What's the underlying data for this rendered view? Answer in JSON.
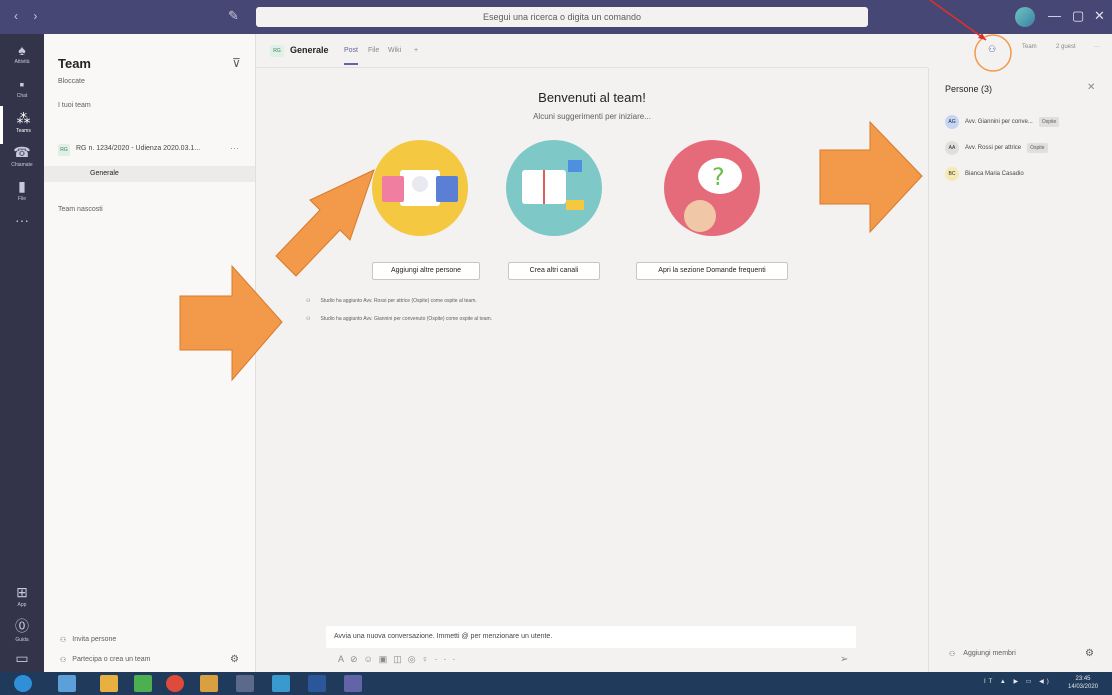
{
  "titlebar": {
    "search_placeholder": "Esegui una ricerca o digita un comando"
  },
  "rail": [
    {
      "label": "Attività",
      "icon": "bell-icon"
    },
    {
      "label": "Chat",
      "icon": "chat-icon"
    },
    {
      "label": "Teams",
      "icon": "teams-icon"
    },
    {
      "label": "Chiamate",
      "icon": "phone-icon"
    },
    {
      "label": "File",
      "icon": "file-icon"
    },
    {
      "label": "App",
      "icon": "apps-icon"
    },
    {
      "label": "Guida",
      "icon": "help-icon"
    }
  ],
  "leftpane": {
    "title": "Team",
    "favorites": "Bloccate",
    "your_teams": "I tuoi team",
    "team_initials": "RG",
    "team_name": "RG n. 1234/2020 - Udienza 2020.03.1...",
    "channel": "Generale",
    "hidden": "Team nascosti",
    "invite": "Invita persone",
    "join": "Partecipa o crea un team"
  },
  "channel": {
    "initials": "RG",
    "name": "Generale",
    "tabs": [
      "Post",
      "File",
      "Wiki",
      "+"
    ],
    "team_btn": "Team",
    "guests": "2 guest",
    "more": "···"
  },
  "welcome": {
    "title": "Benvenuti al team!",
    "subtitle": "Alcuni suggerimenti per iniziare...",
    "buttons": [
      "Aggiungi altre persone",
      "Crea altri canali",
      "Apri la sezione Domande frequenti"
    ]
  },
  "activity": [
    "Studio ha aggiunto Avv. Rossi per attrice (Ospite) come ospite al team.",
    "Studio ha aggiunto Avv. Giannini per convenuto (Ospite) come ospite al team."
  ],
  "composer": {
    "placeholder": "Avvia una nuova conversazione. Immetti @ per menzionare un utente."
  },
  "people": {
    "title": "Persone (3)",
    "members": [
      {
        "initials": "AG",
        "name": "Avv. Giannini per conve...",
        "badge": "Ospite",
        "color": "#c5d6f5"
      },
      {
        "initials": "AA",
        "name": "Avv. Rossi per attrice",
        "badge": "Ospite",
        "color": "#e1dfdd"
      },
      {
        "initials": "BC",
        "name": "Bianca Maria Casadio",
        "badge": "",
        "color": "#f5e9b5"
      }
    ],
    "add": "Aggiungi membri"
  },
  "taskbar": {
    "tray": "IT ▲ ▶ ▭ ◀)",
    "time": "23:45",
    "date": "14/03/2020"
  },
  "colors": {
    "accent": "#6264a7",
    "annotation": "#f2994a",
    "arrow": "#e0302a"
  }
}
